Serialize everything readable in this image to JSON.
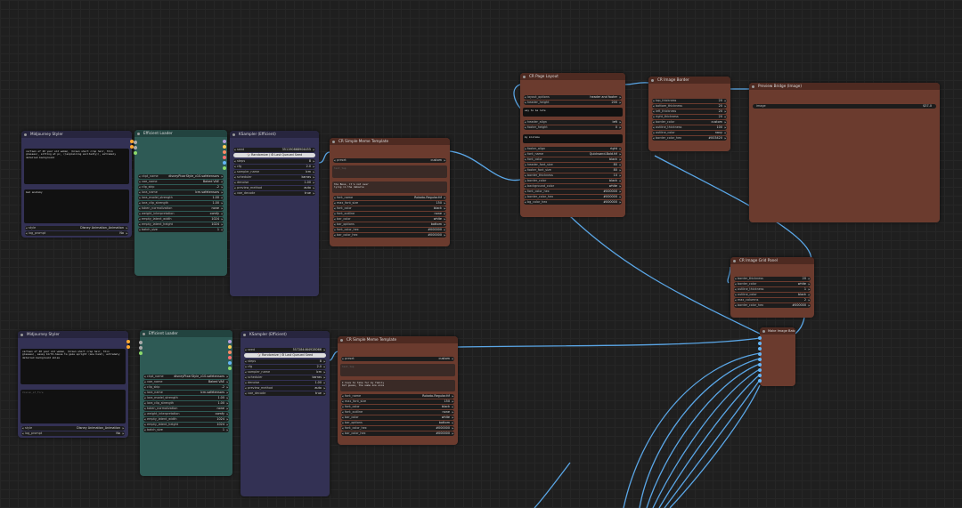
{
  "nodes": {
    "mw1": {
      "title": "Midjourney Styler",
      "prompt": "cartoon of 40 year old woman, (brown short crop hair, thin glasses), sitting at pc, ((explaining excitedly)), extremely detailed background",
      "neg": "bad anatomy",
      "style_label": "style",
      "style_value": "Disney Animation_Animation",
      "log_label": "log_prompt",
      "log_value": "No"
    },
    "mw2": {
      "title": "Midjourney Styler",
      "prompt": "cartoon of 40 year old woman, (brown short crop hair, thin glasses), sassy birth-house to gaze upright (one hand), extremely detailed background skies",
      "neg": "Vision_of_Fire",
      "style_label": "style",
      "style_value": "Disney Animation_Animation",
      "log_label": "log_prompt",
      "log_value": "No"
    },
    "el1": {
      "title": "Efficient Loader",
      "rows": [
        {
          "l": "ckpt_name",
          "v": "disneyPixarStyle_v10.safetensors"
        },
        {
          "l": "vae_name",
          "v": "Baked VAE"
        },
        {
          "l": "clip_skip",
          "v": "-2"
        },
        {
          "l": "lora_name",
          "v": "lcm.safetensors"
        },
        {
          "l": "lora_model_strength",
          "v": "1.00"
        },
        {
          "l": "lora_clip_strength",
          "v": "1.00"
        },
        {
          "l": "token_normalization",
          "v": "none"
        },
        {
          "l": "weight_interpretation",
          "v": "comfy"
        },
        {
          "l": "empty_latent_width",
          "v": "1024"
        },
        {
          "l": "empty_latent_height",
          "v": "1024"
        },
        {
          "l": "batch_size",
          "v": "1"
        }
      ]
    },
    "el2": {
      "title": "Efficient Loader",
      "rows": [
        {
          "l": "ckpt_name",
          "v": "disneyPixarStyle_v10.safetensors"
        },
        {
          "l": "vae_name",
          "v": "Baked VAE"
        },
        {
          "l": "clip_skip",
          "v": "-2"
        },
        {
          "l": "lora_name",
          "v": "lcm.safetensors"
        },
        {
          "l": "lora_model_strength",
          "v": "1.00"
        },
        {
          "l": "lora_clip_strength",
          "v": "1.00"
        },
        {
          "l": "token_normalization",
          "v": "none"
        },
        {
          "l": "weight_interpretation",
          "v": "comfy"
        },
        {
          "l": "empty_latent_width",
          "v": "1024"
        },
        {
          "l": "empty_latent_height",
          "v": "1024"
        },
        {
          "l": "batch_size",
          "v": "1"
        }
      ]
    },
    "ks1": {
      "title": "KSampler (Efficient)",
      "seed_label": "seed",
      "seed_value": "351190868904455",
      "btn": "🎲 Randomize / ♻ Last Queued Seed",
      "rows": [
        {
          "l": "steps",
          "v": "8"
        },
        {
          "l": "cfg",
          "v": "2.0"
        },
        {
          "l": "sampler_name",
          "v": "lcm"
        },
        {
          "l": "scheduler",
          "v": "karras"
        },
        {
          "l": "denoise",
          "v": "1.00"
        },
        {
          "l": "preview_method",
          "v": "auto"
        },
        {
          "l": "vae_decode",
          "v": "true"
        }
      ]
    },
    "ks2": {
      "title": "KSampler (Efficient)",
      "seed_label": "seed",
      "seed_value": "557284464928066",
      "btn": "🎲 Randomize / ♻ Last Queued Seed",
      "rows": [
        {
          "l": "steps",
          "v": "8"
        },
        {
          "l": "cfg",
          "v": "2.0"
        },
        {
          "l": "sampler_name",
          "v": "lcm"
        },
        {
          "l": "scheduler",
          "v": "karras"
        },
        {
          "l": "denoise",
          "v": "1.00"
        },
        {
          "l": "preview_method",
          "v": "auto"
        },
        {
          "l": "vae_decode",
          "v": "true"
        }
      ]
    },
    "mm1": {
      "title": "CR Simple Meme Template",
      "preset_label": "preset",
      "preset_value": "custom",
      "text_top": "text_top",
      "text_bottom": "the Boss, it's not over\nlying in the debacle",
      "rows": [
        {
          "l": "font_name",
          "v": "Roboto-Regular.ttf"
        },
        {
          "l": "max_font_size",
          "v": "150"
        },
        {
          "l": "font_color",
          "v": "black"
        },
        {
          "l": "font_outline",
          "v": "none"
        },
        {
          "l": "bar_color",
          "v": "white"
        },
        {
          "l": "bar_options",
          "v": "bottom"
        },
        {
          "l": "font_color_hex",
          "v": "#000000"
        },
        {
          "l": "bar_color_hex",
          "v": "#000000"
        }
      ]
    },
    "mm2": {
      "title": "CR Simple Meme Template",
      "preset_label": "preset",
      "preset_value": "custom",
      "text_top": "text_top",
      "text_bottom": "I have to take for my family\nbut guess, the same one once",
      "rows": [
        {
          "l": "font_name",
          "v": "Roboto-Regular.ttf"
        },
        {
          "l": "max_font_size",
          "v": "150"
        },
        {
          "l": "font_color",
          "v": "black"
        },
        {
          "l": "font_outline",
          "v": "none"
        },
        {
          "l": "bar_color",
          "v": "white"
        },
        {
          "l": "bar_options",
          "v": "bottom"
        },
        {
          "l": "font_color_hex",
          "v": "#000000"
        },
        {
          "l": "bar_color_hex",
          "v": "#000000"
        }
      ]
    },
    "pl": {
      "title": "CR Page Layout",
      "rows_top": [
        {
          "l": "layout_options",
          "v": "header and footer"
        },
        {
          "l": "header_height",
          "v": "200"
        }
      ],
      "header_text": "way to be late",
      "rows_mid": [
        {
          "l": "header_align",
          "v": "left"
        },
        {
          "l": "footer_height",
          "v": "0"
        }
      ],
      "footer_text": "my mistake",
      "rows_bot": [
        {
          "l": "footer_align",
          "v": "right"
        },
        {
          "l": "font_name",
          "v": "Quicksand-Bold.ttf"
        },
        {
          "l": "font_color",
          "v": "black"
        },
        {
          "l": "header_font_size",
          "v": "80"
        },
        {
          "l": "footer_font_size",
          "v": "80"
        },
        {
          "l": "border_thickness",
          "v": "10"
        },
        {
          "l": "border_color",
          "v": "black"
        },
        {
          "l": "background_color",
          "v": "white"
        },
        {
          "l": "font_color_hex",
          "v": "#000000"
        },
        {
          "l": "border_color_hex",
          "v": "#000000"
        },
        {
          "l": "bg_color_hex",
          "v": "#000000"
        }
      ]
    },
    "ib": {
      "title": "CR Image Border",
      "rows": [
        {
          "l": "top_thickness",
          "v": "20"
        },
        {
          "l": "bottom_thickness",
          "v": "20"
        },
        {
          "l": "left_thickness",
          "v": "20"
        },
        {
          "l": "right_thickness",
          "v": "20"
        },
        {
          "l": "border_color",
          "v": "custom"
        },
        {
          "l": "outline_thickness",
          "v": "100"
        },
        {
          "l": "outline_color",
          "v": "navy"
        },
        {
          "l": "border_color_hex",
          "v": "#003420"
        }
      ]
    },
    "pb": {
      "title": "Preview Bridge (Image)",
      "image_label": "image",
      "image_value": "$37-0"
    },
    "gp": {
      "title": "CR Image Grid Panel",
      "rows": [
        {
          "l": "border_thickness",
          "v": "20"
        },
        {
          "l": "border_color",
          "v": "white"
        },
        {
          "l": "outline_thickness",
          "v": "1"
        },
        {
          "l": "outline_color",
          "v": "black"
        },
        {
          "l": "max_columns",
          "v": "2"
        },
        {
          "l": "border_color_hex",
          "v": "#000000"
        }
      ]
    },
    "mib": {
      "title": "Make Image Batch"
    }
  },
  "colors": {
    "wire": "#5aa6e6",
    "node_purple": "#333154",
    "node_teal": "#2e5a55",
    "node_brown": "#6b3b2e"
  }
}
